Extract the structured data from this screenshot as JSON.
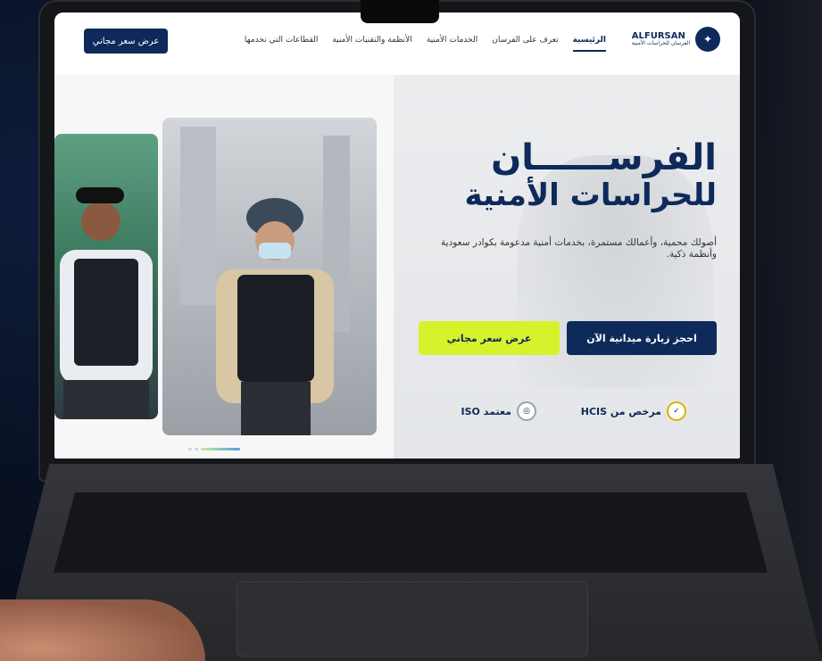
{
  "nav": {
    "cta_label": "عرض سعر مجاني",
    "links": [
      "الرئيسية",
      "تعرف على الفرسان",
      "الخدمات الأمنية",
      "الأنظمة والتقنيات الأمنية",
      "القطاعات التي نخدمها"
    ],
    "logo_en": "ALFURSAN",
    "logo_sub": "الفرسان للحراسات الأمنية"
  },
  "hero": {
    "title_line1": "الفرســــــان",
    "title_line2": "للحراسات الأمنية",
    "subtitle": "أصولك محمية، وأعمالك مستمرة، بخدمات أمنية مدعومة بكوادر سعودية وأنظمة ذكية.",
    "btn_primary": "احجز زيارة ميدانية الآن",
    "btn_secondary": "عرض سعر مجاني",
    "badge_hcis": "مرخص من HCIS",
    "badge_iso": "معتمد ISO"
  },
  "colors": {
    "primary": "#0d2a5a",
    "accent": "#d6f22b"
  },
  "icons": {
    "hcis": "shield-icon",
    "iso": "certificate-icon"
  }
}
